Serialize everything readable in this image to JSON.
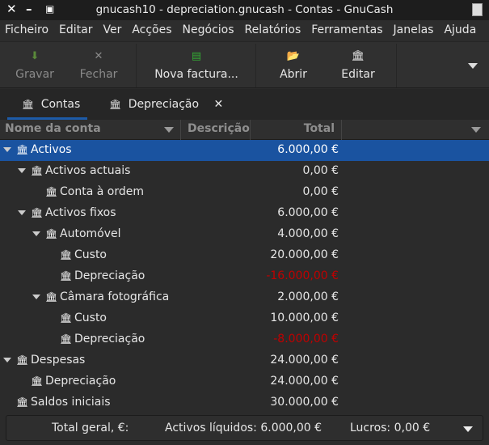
{
  "window": {
    "title": "gnucash10 - depreciation.gnucash - Contas - GnuCash"
  },
  "menu": [
    "Ficheiro",
    "Editar",
    "Ver",
    "Acções",
    "Negócios",
    "Relatórios",
    "Ferramentas",
    "Janelas",
    "Ajuda"
  ],
  "toolbar": {
    "save": "Gravar",
    "close": "Fechar",
    "new_invoice": "Nova factura...",
    "open": "Abrir",
    "edit": "Editar"
  },
  "tabs": [
    {
      "label": "Contas"
    },
    {
      "label": "Depreciação"
    }
  ],
  "columns": {
    "name": "Nome da conta",
    "description": "Descrição",
    "total": "Total"
  },
  "accounts": [
    {
      "name": "Activos",
      "total": "6.000,00 €",
      "level": 0,
      "expanded": true,
      "selected": true,
      "negative": false
    },
    {
      "name": "Activos actuais",
      "total": "0,00 €",
      "level": 1,
      "expanded": true,
      "negative": false
    },
    {
      "name": "Conta à ordem",
      "total": "0,00 €",
      "level": 2,
      "expanded": false,
      "negative": false
    },
    {
      "name": "Activos fixos",
      "total": "6.000,00 €",
      "level": 1,
      "expanded": true,
      "negative": false
    },
    {
      "name": "Automóvel",
      "total": "4.000,00 €",
      "level": 2,
      "expanded": true,
      "negative": false
    },
    {
      "name": "Custo",
      "total": "20.000,00 €",
      "level": 3,
      "expanded": false,
      "negative": false
    },
    {
      "name": "Depreciação",
      "total": "-16.000,00 €",
      "level": 3,
      "expanded": false,
      "negative": true
    },
    {
      "name": "Câmara fotográfica",
      "total": "2.000,00 €",
      "level": 2,
      "expanded": true,
      "negative": false
    },
    {
      "name": "Custo",
      "total": "10.000,00 €",
      "level": 3,
      "expanded": false,
      "negative": false
    },
    {
      "name": "Depreciação",
      "total": "-8.000,00 €",
      "level": 3,
      "expanded": false,
      "negative": true
    },
    {
      "name": "Despesas",
      "total": "24.000,00 €",
      "level": 0,
      "expanded": true,
      "negative": false
    },
    {
      "name": "Depreciação",
      "total": "24.000,00 €",
      "level": 1,
      "expanded": false,
      "negative": false
    },
    {
      "name": "Saldos iniciais",
      "total": "30.000,00 €",
      "level": 0,
      "expanded": false,
      "negative": false
    }
  ],
  "footer": {
    "grand_total": "Total geral, €:",
    "net_assets": "Activos líquidos: 6.000,00 €",
    "profit": "Lucros: 0,00 €"
  }
}
